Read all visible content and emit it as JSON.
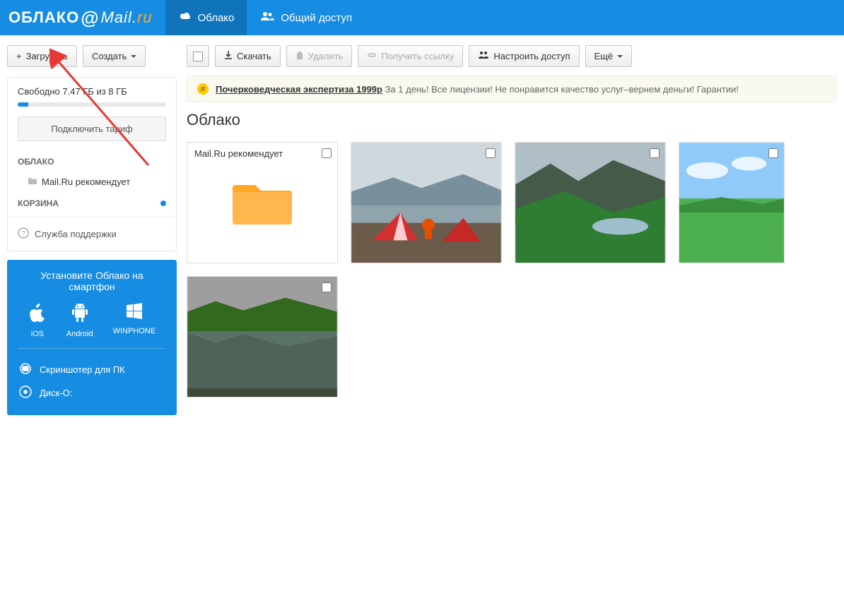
{
  "header": {
    "logo_text": "ОБЛАКО",
    "logo_at": "@",
    "logo_mail": "Mail.",
    "logo_ru": "ru",
    "tabs": [
      {
        "label": "Облако",
        "active": true
      },
      {
        "label": "Общий доступ",
        "active": false
      }
    ]
  },
  "sidebar": {
    "upload_label": "Загрузить",
    "create_label": "Создать",
    "storage_text": "Свободно 7.47 ГБ из 8 ГБ",
    "storage_percent_used": 7,
    "plan_button": "Подключить тариф",
    "sections": {
      "cloud_heading": "ОБЛАКО",
      "cloud_item": "Mail.Ru рекомендует",
      "trash_heading": "КОРЗИНА"
    },
    "support_label": "Служба поддержки",
    "promo": {
      "title": "Установите Облако на смартфон",
      "platforms": [
        {
          "name": "iOS"
        },
        {
          "name": "Android"
        },
        {
          "name": "WINPHONE"
        }
      ],
      "links": [
        {
          "label": "Скриншотер для ПК"
        },
        {
          "label": "Диск-О:"
        }
      ]
    }
  },
  "toolbar": {
    "download": "Скачать",
    "delete": "Удалить",
    "get_link": "Получить ссылку",
    "configure_access": "Настроить доступ",
    "more": "Ещё"
  },
  "ad": {
    "link_text": "Почерковедческая экспертиза 1999р",
    "rest": "За 1 день! Все лицензии! Не понравится качество услуг–вернем деньги! Гарантии!"
  },
  "page_title": "Облако",
  "tiles": [
    {
      "type": "folder",
      "label": "Mail.Ru рекомендует"
    },
    {
      "type": "image"
    },
    {
      "type": "image"
    },
    {
      "type": "image"
    },
    {
      "type": "image"
    }
  ]
}
